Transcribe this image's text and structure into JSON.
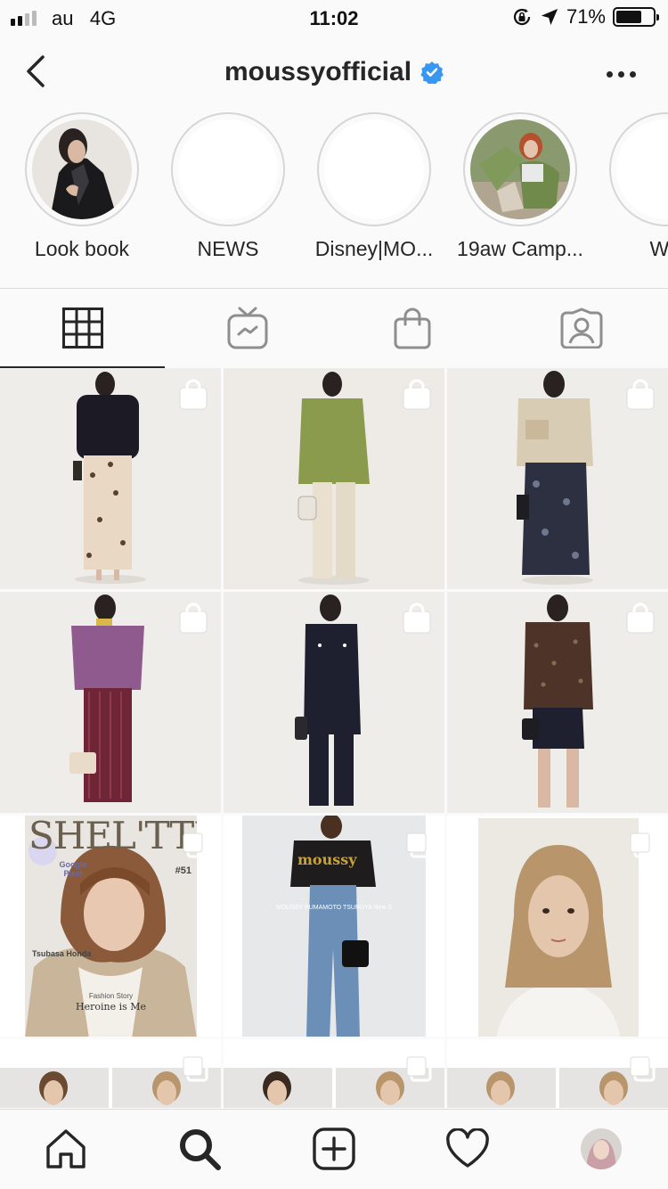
{
  "status_bar": {
    "carrier": "au",
    "network": "4G",
    "time": "11:02",
    "battery_text": "71%",
    "battery_level": 0.71,
    "icons": [
      "signal-bars-icon",
      "orientation-lock-icon",
      "location-arrow-icon",
      "battery-icon"
    ]
  },
  "header": {
    "username": "moussyofficial",
    "verified": true,
    "icons": [
      "back-chevron-icon",
      "verified-badge-icon",
      "more-dots-icon"
    ]
  },
  "highlights": [
    {
      "label": "Look book",
      "has_cover": true
    },
    {
      "label": "NEWS",
      "has_cover": false
    },
    {
      "label": "Disney|MO...",
      "has_cover": false
    },
    {
      "label": "19aw Camp...",
      "has_cover": true
    },
    {
      "label": "WS",
      "has_cover": false
    }
  ],
  "tabs": [
    {
      "icon": "grid-icon",
      "active": true
    },
    {
      "icon": "igtv-icon",
      "active": false
    },
    {
      "icon": "shopping-bag-icon",
      "active": false
    },
    {
      "icon": "tagged-person-icon",
      "active": false
    }
  ],
  "posts": {
    "colors": {
      "backdrop": "#efedea",
      "white": "#ffffff"
    },
    "badge_icons": [
      "shop-bag-badge-icon",
      "multi-photo-badge-icon"
    ],
    "magazine": {
      "title": "SHEL'TTER",
      "issue": "#51",
      "name": "Tsubasa Honda",
      "story": "Fashion Story",
      "story_title": "Heroine is Me",
      "sticker_brand": "Google Pixel"
    },
    "tee_logo": "moussy",
    "promo_line": "MOUSSY KUMAMOTO TSURUYA New S"
  },
  "bottom_nav": {
    "icons": [
      "home-icon",
      "search-icon",
      "new-post-icon",
      "activity-heart-icon",
      "profile-avatar-icon"
    ]
  }
}
